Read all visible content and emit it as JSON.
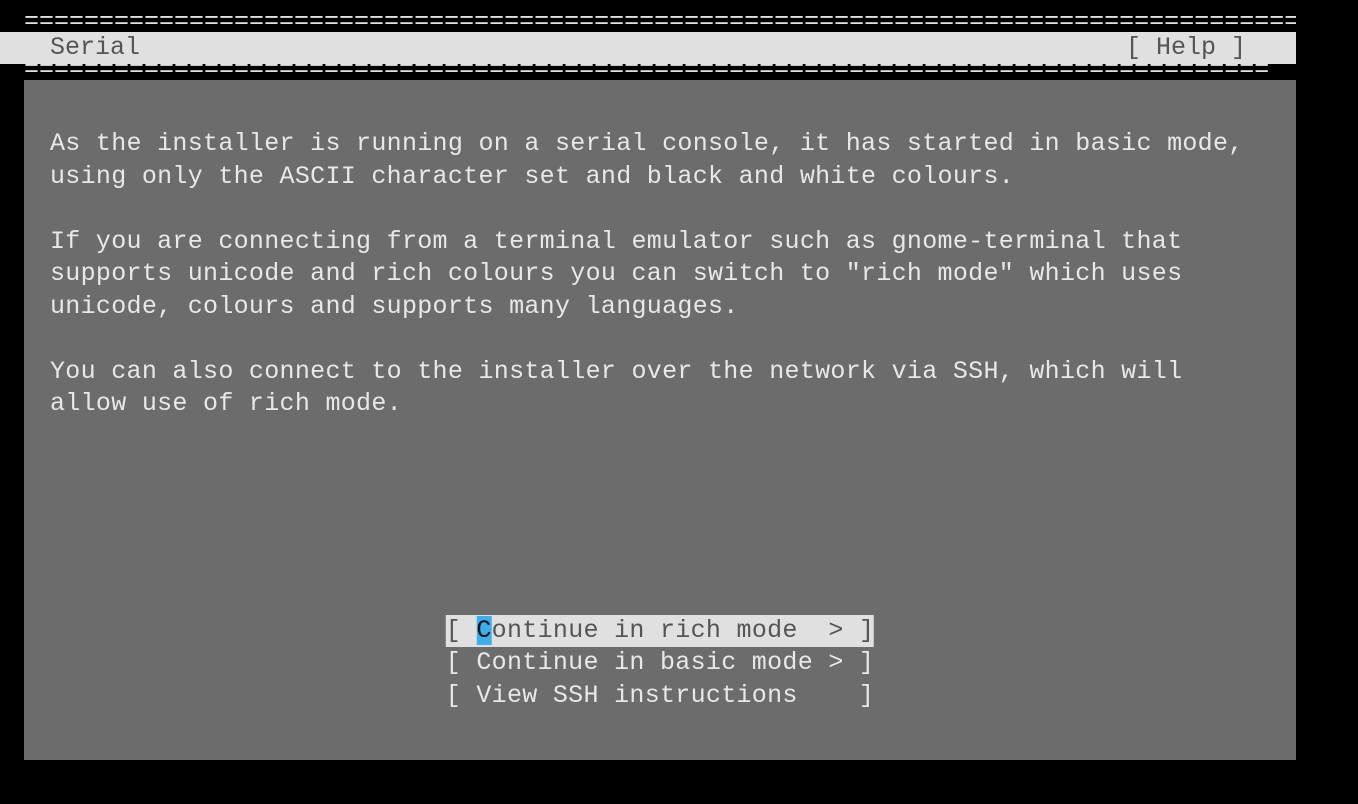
{
  "header": {
    "border": "======================================================================================",
    "title": "Serial",
    "help_label": "[ Help ]"
  },
  "body": {
    "paragraph1": "As the installer is running on a serial console, it has started in basic mode, using only the ASCII character set and black and white colours.",
    "paragraph2": "If you are connecting from a terminal emulator such as gnome-terminal that supports unicode and rich colours you can switch to \"rich mode\" which uses unicode, colours and supports many languages.",
    "paragraph3": "You can also connect to the installer over the network via SSH, which will allow use of rich mode."
  },
  "menu": {
    "item1_prefix": "[ ",
    "item1_first": "C",
    "item1_rest": "ontinue in rich mode  > ]",
    "item2": "[ Continue in basic mode > ]",
    "item3": "[ View SSH instructions    ]"
  }
}
